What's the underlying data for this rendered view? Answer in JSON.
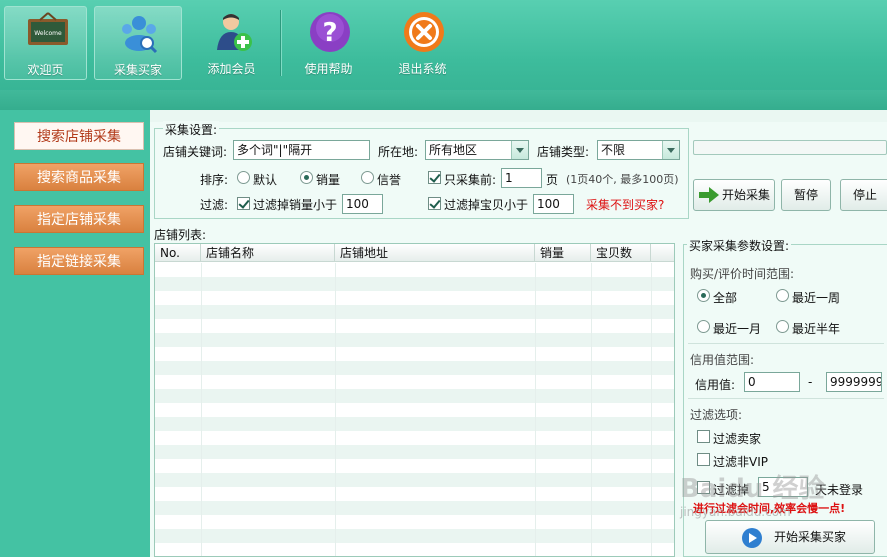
{
  "toolbar": {
    "buttons": [
      {
        "label": "欢迎页",
        "icon": "welcome-board-icon"
      },
      {
        "label": "采集买家",
        "icon": "collect-buyers-icon"
      },
      {
        "label": "添加会员",
        "icon": "add-member-icon"
      },
      {
        "label": "使用帮助",
        "icon": "help-icon"
      },
      {
        "label": "退出系统",
        "icon": "exit-icon"
      }
    ],
    "welcome_board_text": "Welcome"
  },
  "sidebar": {
    "items": [
      {
        "label": "搜索店铺采集",
        "active": true
      },
      {
        "label": "搜索商品采集",
        "active": false
      },
      {
        "label": "指定店铺采集",
        "active": false
      },
      {
        "label": "指定链接采集",
        "active": false
      }
    ]
  },
  "settings": {
    "legend": "采集设置:",
    "keyword_label": "店铺关键词:",
    "keyword_value": "多个词\"|\"隔开",
    "location_label": "所在地:",
    "location_value": "所有地区",
    "shop_type_label": "店铺类型:",
    "shop_type_value": "不限",
    "sort_label": "排序:",
    "sort_options": [
      "默认",
      "销量",
      "信誉"
    ],
    "sort_selected": "销量",
    "only_first_label": "只采集前:",
    "only_first_value": "1",
    "page_unit": "页",
    "page_note": "(1页40个, 最多100页)",
    "filter_label": "过滤:",
    "filter_sales_label": "过滤掉销量小于",
    "filter_sales_value": "100",
    "filter_items_label": "过滤掉宝贝小于",
    "filter_items_value": "100",
    "cannot_collect_link": "采集不到买家?",
    "start_button": "开始采集",
    "pause_button": "暂停",
    "stop_button": "停止"
  },
  "shop_list": {
    "title": "店铺列表:",
    "columns": [
      "No.",
      "店铺名称",
      "店铺地址",
      "销量",
      "宝贝数"
    ]
  },
  "buyer_params": {
    "legend": "买家采集参数设置:",
    "time_range_label": "购买/评价时间范围:",
    "time_options": [
      "全部",
      "最近一周",
      "最近一月",
      "最近半年"
    ],
    "time_selected": "全部",
    "credit_range_label": "信用值范围:",
    "credit_label": "信用值:",
    "credit_min": "0",
    "credit_dash": "-",
    "credit_max": "9999999",
    "filter_options_label": "过滤选项:",
    "filter_seller": "过滤卖家",
    "filter_non_vip": "过滤非VIP",
    "filter_days_prefix": "过滤掉",
    "filter_days_value": "5",
    "filter_days_suffix": "天未登录",
    "warning": "进行过滤会时间,效率会慢一点!",
    "start_buyer_button": "开始采集买家"
  },
  "watermark": "Baidu 经验",
  "watermark_url": "jingyan.baidu.com",
  "colors": {
    "toolbar": "#45c4a4",
    "sidebar": "#44c2a3",
    "nav_orange": "#e08c4c",
    "warning_red": "#dd1111"
  }
}
